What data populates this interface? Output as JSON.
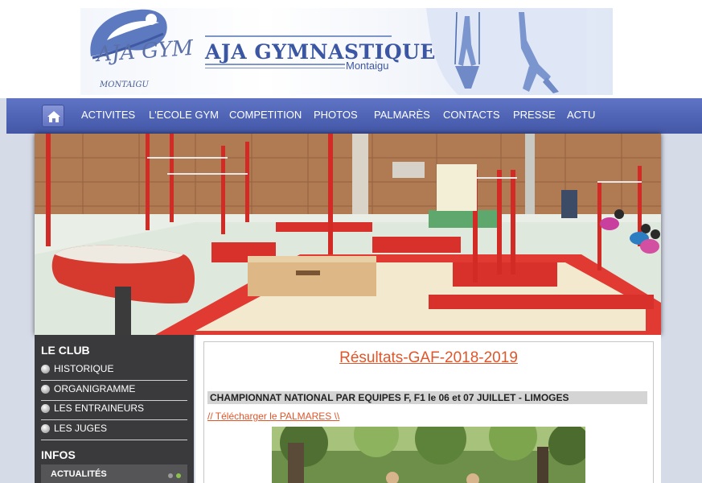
{
  "header": {
    "logo_text": "AJA GYM",
    "logo_sub": "MONTAIGU",
    "brand_prefix": "AJA",
    "brand_name": "GYMNASTIQUE",
    "brand_location": "Montaigu"
  },
  "nav": {
    "home_icon": "home-icon",
    "items": [
      "ACTIVITES",
      "L'ECOLE GYM",
      "COMPETITION",
      "PHOTOS",
      "PALMARÈS",
      "CONTACTS",
      "PRESSE",
      "ACTU"
    ]
  },
  "sidebar": {
    "club_heading": "LE CLUB",
    "club_items": [
      "HISTORIQUE",
      "ORGANIGRAMME",
      "LES ENTRAINEURS",
      "LES JUGES"
    ],
    "infos_heading": "INFOS",
    "news_label": "ACTUALITÉS"
  },
  "main": {
    "title": "Résultats-GAF-2018-2019",
    "section_heading": "CHAMPIONNAT NATIONAL PAR EQUIPES F, F1 le 06 et 07 JUILLET - LIMOGES",
    "download_link": "// Télécharger le PALMARES \\\\"
  },
  "colors": {
    "nav_blue": "#4e62b4",
    "brand_blue": "#3b56a3",
    "accent_orange": "#e0562a",
    "sidebar_dark": "#3a3a3c"
  }
}
